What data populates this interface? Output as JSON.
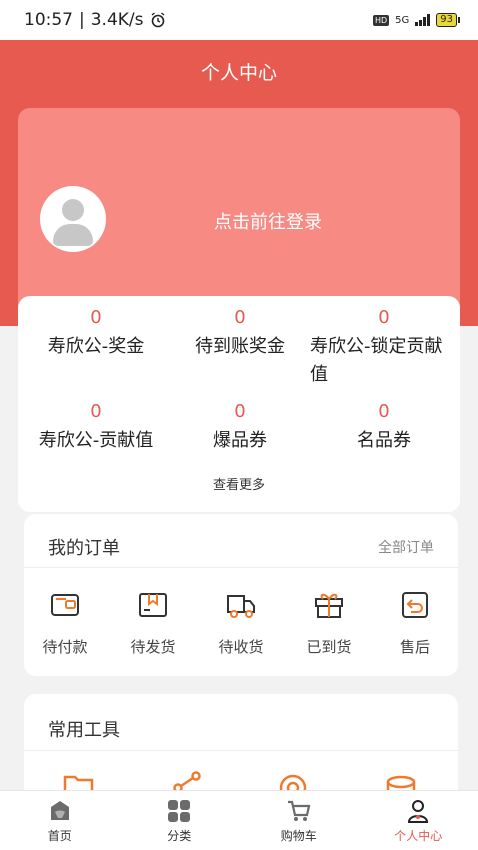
{
  "status_bar": {
    "time": "10:57",
    "speed": "3.4K/s",
    "network": "5G",
    "hd": "HD",
    "battery": "93"
  },
  "header": {
    "title": "个人中心"
  },
  "profile": {
    "login_text": "点击前往登录"
  },
  "stats": {
    "items": [
      {
        "value": "0",
        "label": "寿欣公-奖金"
      },
      {
        "value": "0",
        "label": "待到账奖金"
      },
      {
        "value": "0",
        "label": "寿欣公-锁定贡献值"
      },
      {
        "value": "0",
        "label": "寿欣公-贡献值"
      },
      {
        "value": "0",
        "label": "爆品券"
      },
      {
        "value": "0",
        "label": "名品券"
      }
    ],
    "more": "查看更多"
  },
  "orders": {
    "title": "我的订单",
    "all_label": "全部订单",
    "items": [
      {
        "label": "待付款",
        "icon": "wallet-icon"
      },
      {
        "label": "待发货",
        "icon": "box-icon"
      },
      {
        "label": "待收货",
        "icon": "truck-icon"
      },
      {
        "label": "已到货",
        "icon": "gift-icon"
      },
      {
        "label": "售后",
        "icon": "return-icon"
      }
    ]
  },
  "tools": {
    "title": "常用工具",
    "icons": [
      "folder-icon",
      "share-icon",
      "target-icon",
      "coins-icon"
    ]
  },
  "bottom_nav": {
    "items": [
      {
        "label": "首页",
        "icon": "home-icon"
      },
      {
        "label": "分类",
        "icon": "category-icon"
      },
      {
        "label": "购物车",
        "icon": "cart-icon"
      },
      {
        "label": "个人中心",
        "icon": "user-icon",
        "active": true
      }
    ]
  },
  "colors": {
    "accent": "#e65a4f",
    "card_pink": "#f88a84",
    "tool_orange": "#f07a2c"
  }
}
